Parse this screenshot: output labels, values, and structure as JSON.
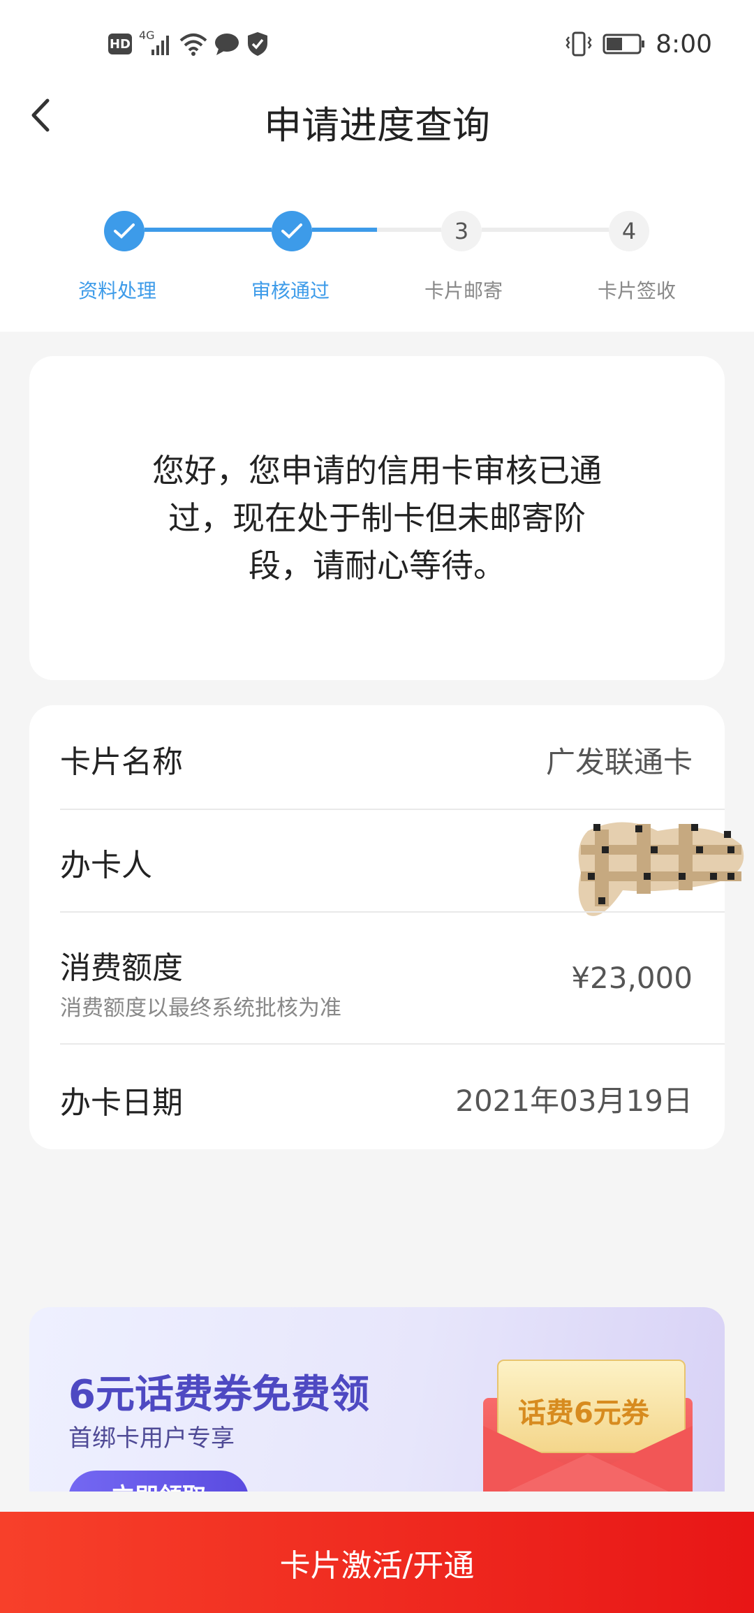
{
  "status_bar": {
    "hd": "HD",
    "network": "4G",
    "time": "8:00",
    "icons": [
      "hd-icon",
      "signal-icon",
      "wifi-icon",
      "message-icon",
      "shield-icon",
      "vibrate-icon",
      "battery-icon"
    ]
  },
  "header": {
    "back_icon": "chevron-left-icon",
    "title": "申请进度查询"
  },
  "steps": [
    {
      "number": "1",
      "label": "资料处理",
      "done": true
    },
    {
      "number": "2",
      "label": "审核通过",
      "done": true
    },
    {
      "number": "3",
      "label": "卡片邮寄",
      "done": false
    },
    {
      "number": "4",
      "label": "卡片签收",
      "done": false
    }
  ],
  "message": {
    "line1": "您好，您申请的信用卡审核已通",
    "line2": "过，现在处于制卡但未邮寄阶",
    "line3": "段，请耐心等待。"
  },
  "info": {
    "card_name_label": "卡片名称",
    "card_name_value": "广发联通卡",
    "holder_label": "办卡人",
    "limit_label": "消费额度",
    "limit_note": "消费额度以最终系统批核为准",
    "limit_value": "¥23,000",
    "date_label": "办卡日期",
    "date_value": "2021年03月19日"
  },
  "banner": {
    "title": "6元话费券免费领",
    "subtitle": "首绑卡用户专享",
    "button": "立即领取",
    "coupon_text": "话费6元券"
  },
  "cta": {
    "label": "卡片激活/开通"
  },
  "colors": {
    "accent": "#3d9be9",
    "cta": "#f0261c",
    "banner_title": "#4e49c2"
  }
}
